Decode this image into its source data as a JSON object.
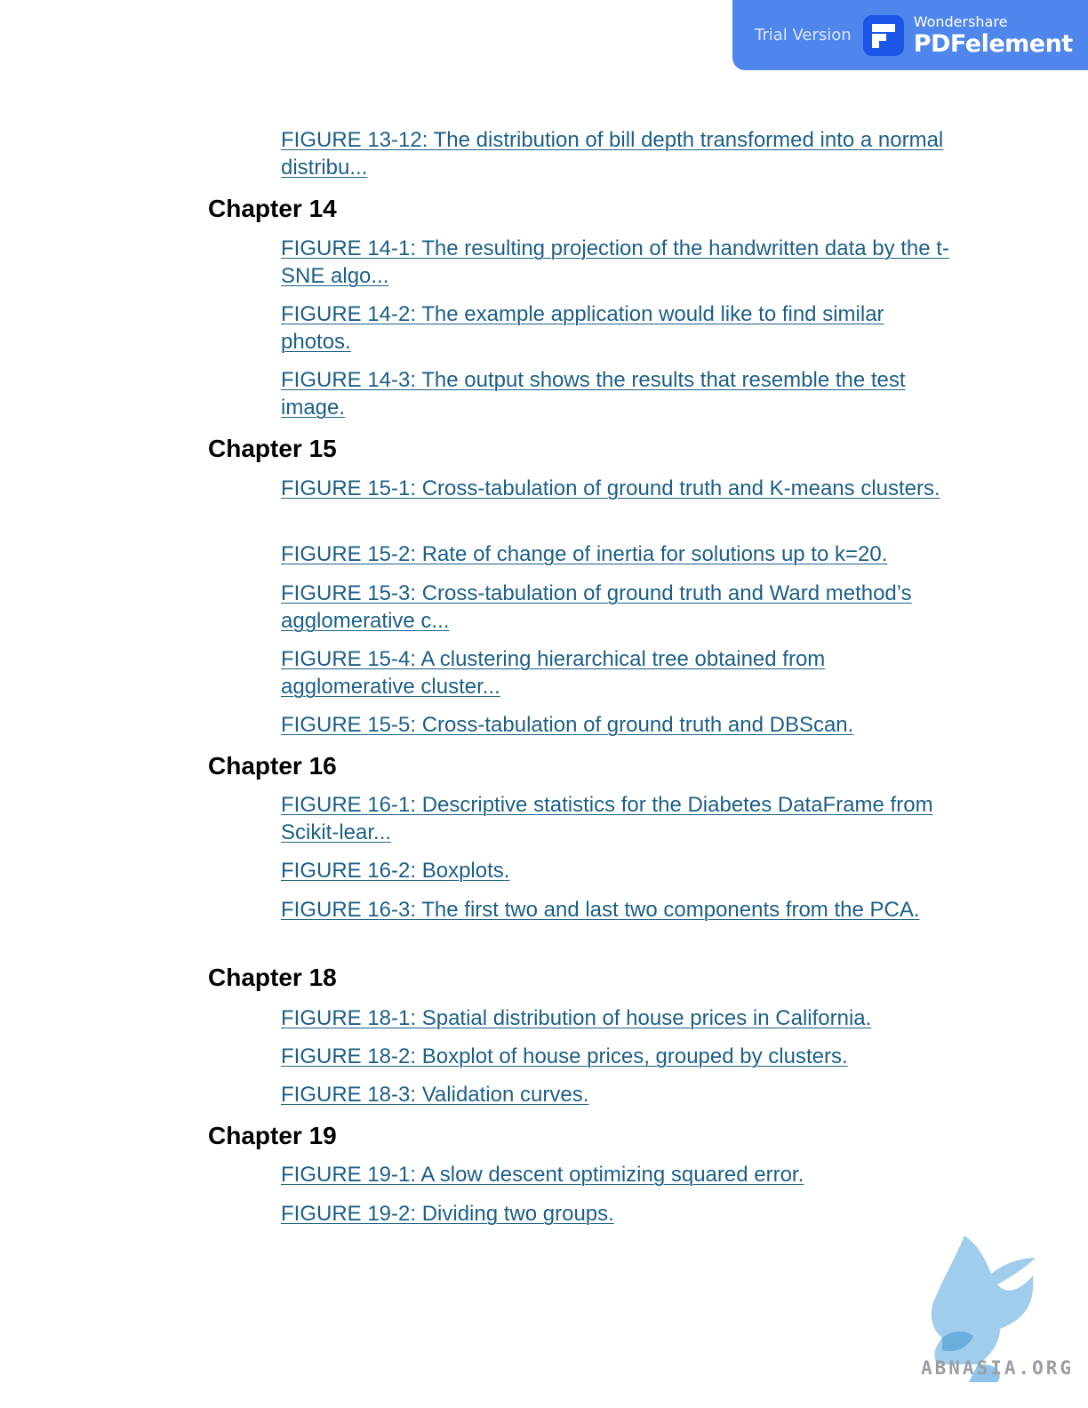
{
  "banner": {
    "trial_label": "Trial Version",
    "brand_small": "Wondershare",
    "brand_big": "PDFelement"
  },
  "toc": [
    {
      "type": "link",
      "text": "FIGURE 13-12: The distribution of bill depth transformed into a normal distribu..."
    },
    {
      "type": "chapter",
      "text": "Chapter 14"
    },
    {
      "type": "link",
      "text": "FIGURE 14-1: The resulting projection of the handwritten data by the t-SNE algo..."
    },
    {
      "type": "link",
      "text": "FIGURE 14-2: The example application would like to find similar photos."
    },
    {
      "type": "link",
      "text": "FIGURE 14-3: The output shows the results that resemble the test image."
    },
    {
      "type": "chapter",
      "text": "Chapter 15"
    },
    {
      "type": "link",
      "text": "FIGURE 15-1: Cross-tabulation of ground truth and K-means clusters."
    },
    {
      "type": "link",
      "text": "FIGURE 15-2: Rate of change of inertia for solutions up to k=20."
    },
    {
      "type": "link",
      "text": "FIGURE 15-3: Cross-tabulation of ground truth and Ward method’s agglomerative c..."
    },
    {
      "type": "link",
      "text": "FIGURE 15-4: A clustering hierarchical tree obtained from agglomerative cluster..."
    },
    {
      "type": "link",
      "text": "FIGURE 15-5: Cross-tabulation of ground truth and DBScan."
    },
    {
      "type": "chapter",
      "text": "Chapter 16"
    },
    {
      "type": "link",
      "text": "FIGURE 16-1: Descriptive statistics for the Diabetes DataFrame from Scikit-lear..."
    },
    {
      "type": "link",
      "text": "FIGURE 16-2: Boxplots."
    },
    {
      "type": "link",
      "text": "FIGURE 16-3: The first two and last two components from the PCA."
    },
    {
      "type": "chapter",
      "text": "Chapter 18"
    },
    {
      "type": "link",
      "text": "FIGURE 18-1: Spatial distribution of house prices in California."
    },
    {
      "type": "link",
      "text": "FIGURE 18-2: Boxplot of house prices, grouped by clusters."
    },
    {
      "type": "link",
      "text": "FIGURE 18-3: Validation curves."
    },
    {
      "type": "chapter",
      "text": "Chapter 19"
    },
    {
      "type": "link",
      "text": "FIGURE 19-1: A slow descent optimizing squared error."
    },
    {
      "type": "link",
      "text": "FIGURE 19-2: Dividing two groups."
    }
  ],
  "watermark": {
    "text": "ABNASIA.ORG"
  },
  "colors": {
    "link": "#1b5f86",
    "banner": "#4f86ec",
    "heading": "#000000"
  }
}
